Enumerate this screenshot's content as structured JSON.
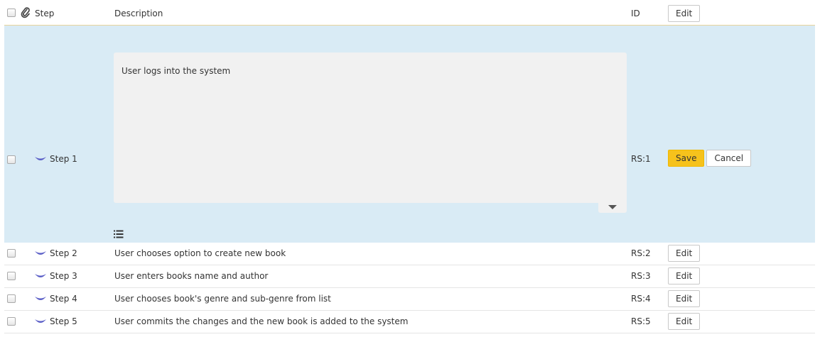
{
  "header": {
    "step_label": "Step",
    "description_label": "Description",
    "id_label": "ID",
    "edit_label": "Edit"
  },
  "editing_row": {
    "step": "Step 1",
    "description": "User logs into the system",
    "id": "RS:1",
    "save_label": "Save",
    "cancel_label": "Cancel"
  },
  "rows": [
    {
      "step": "Step 2",
      "description": "User chooses option to create new book",
      "id": "RS:2",
      "edit_label": "Edit"
    },
    {
      "step": "Step 3",
      "description": "User enters books name and author",
      "id": "RS:3",
      "edit_label": "Edit"
    },
    {
      "step": "Step 4",
      "description": "User chooses book's genre and sub-genre from list",
      "id": "RS:4",
      "edit_label": "Edit"
    },
    {
      "step": "Step 5",
      "description": "User commits the changes and the new book is added to the system",
      "id": "RS:5",
      "edit_label": "Edit"
    }
  ],
  "icons": {
    "attachment": "paperclip-icon",
    "step": "step-arc-icon",
    "editor_toggle": "caret-down-icon",
    "list": "list-icon"
  },
  "colors": {
    "editing_background": "#d9ebf5",
    "save_button": "#f6c21c",
    "step_icon": "#5b5fc7",
    "header_border": "#e8d49a"
  }
}
